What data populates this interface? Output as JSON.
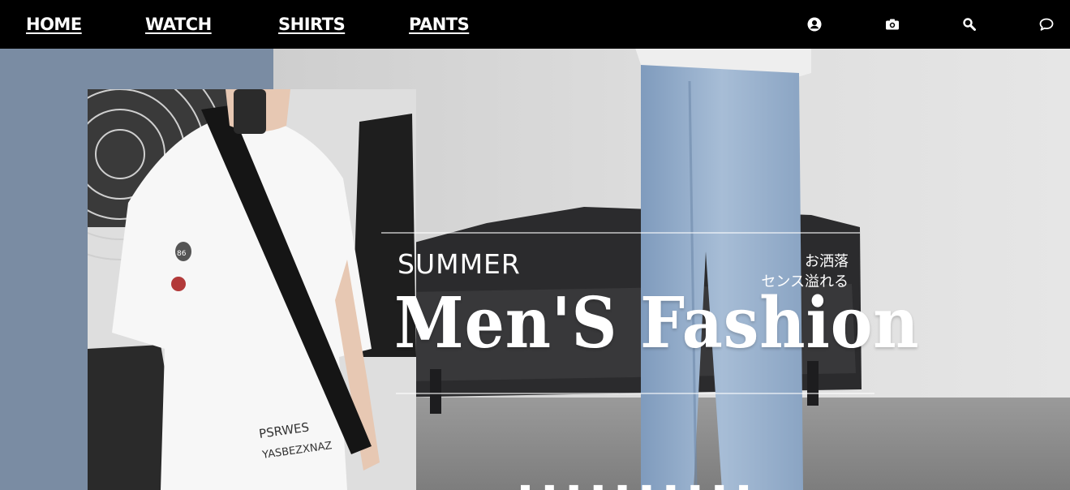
{
  "nav": {
    "links": [
      {
        "label": "HOME"
      },
      {
        "label": "WATCH"
      },
      {
        "label": "SHIRTS"
      },
      {
        "label": "PANTS"
      }
    ],
    "icons": [
      "user-icon",
      "camera-icon",
      "search-icon",
      "chat-icon"
    ]
  },
  "hero": {
    "kicker": "SUMMER",
    "tagline_line1": "お洒落",
    "tagline_line2": "センス溢れる",
    "headline": "Men'S Fashion",
    "photo_shirt_print_line1": "PSRWES",
    "photo_shirt_print_line2": "YASBEZXNAZ",
    "photo_shirt_badge": "86"
  },
  "colors": {
    "navbar": "#000000",
    "nav_text": "#ffffff",
    "hero_panel_blue": "#7a8ca3",
    "headline_text": "#ffffff"
  }
}
